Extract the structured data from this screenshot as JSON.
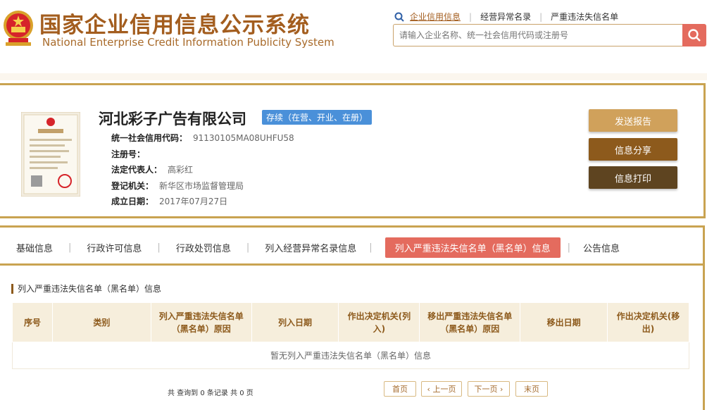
{
  "header": {
    "title_cn": "国家企业信用信息公示系统",
    "title_en": "National Enterprise Credit Information Publicity System",
    "links": [
      "企业信用信息",
      "经营异常名录",
      "严重违法失信名单"
    ],
    "search_placeholder": "请输入企业名称、统一社会信用代码或注册号",
    "colors": {
      "brand": "#a35d1e",
      "accent": "#e46b5e"
    }
  },
  "company": {
    "name": "河北彩子广告有限公司",
    "status": "存续（在营、开业、在册）",
    "fields": [
      {
        "label": "统一社会信用代码：",
        "value": "91130105MA08UHFU58"
      },
      {
        "label": "注册号：",
        "value": ""
      },
      {
        "label": "法定代表人：",
        "value": "高彩红"
      },
      {
        "label": "登记机关：",
        "value": "新华区市场监督管理局"
      },
      {
        "label": "成立日期：",
        "value": "2017年07月27日"
      }
    ],
    "actions": {
      "report": "发送报告",
      "share": "信息分享",
      "print": "信息打印"
    }
  },
  "tabs": [
    "基础信息",
    "行政许可信息",
    "行政处罚信息",
    "列入经营异常名录信息",
    "列入严重违法失信名单（黑名单）信息",
    "公告信息"
  ],
  "active_tab": "列入严重违法失信名单（黑名单）信息",
  "section": {
    "title": "列入严重违法失信名单（黑名单）信息",
    "columns": [
      "序号",
      "类别",
      "列入严重违法失信名单（黑名单）原因",
      "列入日期",
      "作出决定机关(列入)",
      "移出严重违法失信名单（黑名单）原因",
      "移出日期",
      "作出决定机关(移出)"
    ],
    "empty_text": "暂无列入严重违法失信名单（黑名单）信息"
  },
  "pager": {
    "info": "共 查询到 0 条记录 共 0 页",
    "first": "首页",
    "prev": "‹ 上一页",
    "next": "下一页 ›",
    "last": "末页"
  }
}
